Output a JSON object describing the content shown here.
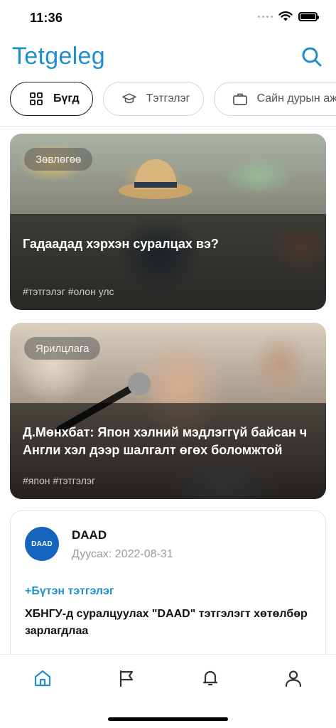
{
  "status_bar": {
    "time": "11:36"
  },
  "header": {
    "logo_text": "Tetgeleg"
  },
  "filters": [
    {
      "label": "Бүгд",
      "icon": "grid-icon",
      "active": true
    },
    {
      "label": "Тэтгэлэг",
      "icon": "graduation-cap-icon",
      "active": false
    },
    {
      "label": "Сайн дурын ажил",
      "icon": "briefcase-icon",
      "active": false
    }
  ],
  "articles": [
    {
      "tag": "Зөвлөгөө",
      "title": "Гадаадад хэрхэн суралцах вэ?",
      "hashtags": "#тэтгэлэг #олон улс"
    },
    {
      "tag": "Ярилцлага",
      "title": "Д.Мөнхбат: Япон хэлний мэдлэггүй байсан ч Англи хэл дээр шалгалт өгөх боломжтой",
      "hashtags": "#япон #тэтгэлэг"
    }
  ],
  "scholarship": {
    "logo_text": "DAAD",
    "org": "DAAD",
    "deadline": "Дуусах: 2022-08-31",
    "more": "+Бүтэн тэтгэлэг",
    "title": "ХБНГУ-д суралцуулах \"DAAD\" тэтгэлэгт хөтөлбөр зарлагдлаа"
  },
  "nav": [
    {
      "icon": "home-icon",
      "active": true
    },
    {
      "icon": "flag-icon",
      "active": false
    },
    {
      "icon": "bell-icon",
      "active": false
    },
    {
      "icon": "profile-icon",
      "active": false
    }
  ],
  "colors": {
    "brand": "#1f8ecf",
    "nav_active": "#1f8ecf",
    "logo_bg": "#1565c0"
  }
}
